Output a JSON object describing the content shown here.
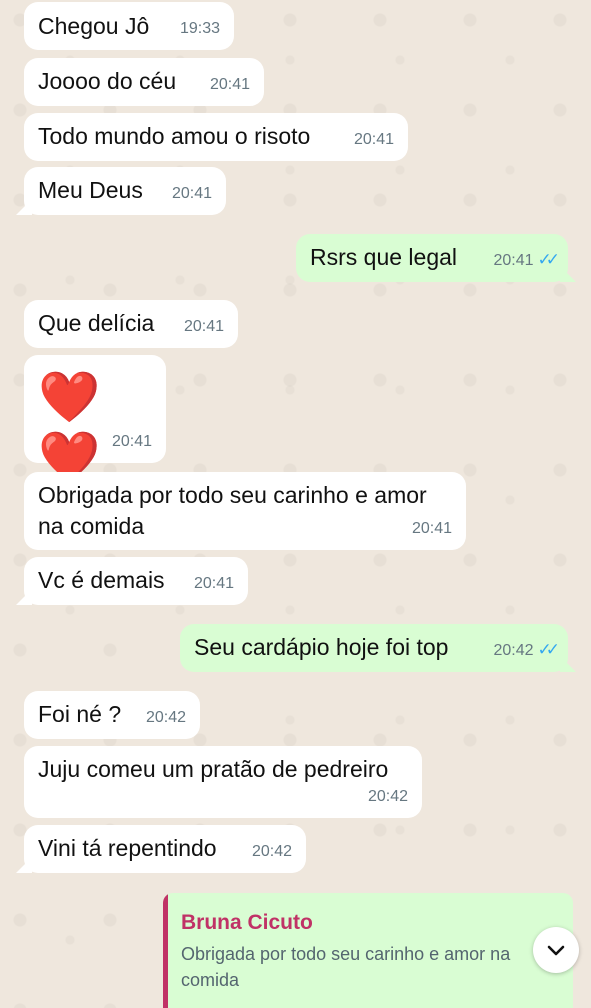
{
  "messages": [
    {
      "text": "Chegou Jô",
      "time": "19:33",
      "dir": "in"
    },
    {
      "text": "Joooo do céu",
      "time": "20:41",
      "dir": "in"
    },
    {
      "text": "Todo mundo amou o risoto",
      "time": "20:41",
      "dir": "in"
    },
    {
      "text": "Meu Deus",
      "time": "20:41",
      "dir": "in"
    },
    {
      "text": "Rsrs que legal",
      "time": "20:41",
      "dir": "out",
      "read": true
    },
    {
      "text": "Que delícia",
      "time": "20:41",
      "dir": "in"
    },
    {
      "text": "❤️❤️",
      "time": "20:41",
      "dir": "in",
      "emoji_only": true
    },
    {
      "text": "Obrigada por todo seu carinho e amor\nna comida",
      "time": "20:41",
      "dir": "in"
    },
    {
      "text": "Vc é demais",
      "time": "20:41",
      "dir": "in"
    },
    {
      "text": "Seu cardápio hoje foi top",
      "time": "20:42",
      "dir": "out",
      "read": true
    },
    {
      "text": "Foi né ?",
      "time": "20:42",
      "dir": "in"
    },
    {
      "text": "Juju comeu um pratão de pedreiro",
      "time": "20:42",
      "dir": "in"
    },
    {
      "text": "Vini tá repentindo",
      "time": "20:42",
      "dir": "in"
    }
  ],
  "reply": {
    "author": "Bruna Cicuto",
    "quoted": "Obrigada por todo seu carinho e amor na comida"
  },
  "icons": {
    "read_ticks": "double-check-icon",
    "scroll_down": "chevron-down-icon"
  },
  "colors": {
    "incoming": "#ffffff",
    "outgoing": "#d9fdd3",
    "read_ticks": "#34a8f0",
    "reply_accent": "#c03266",
    "wallpaper": "#efe7dd"
  }
}
